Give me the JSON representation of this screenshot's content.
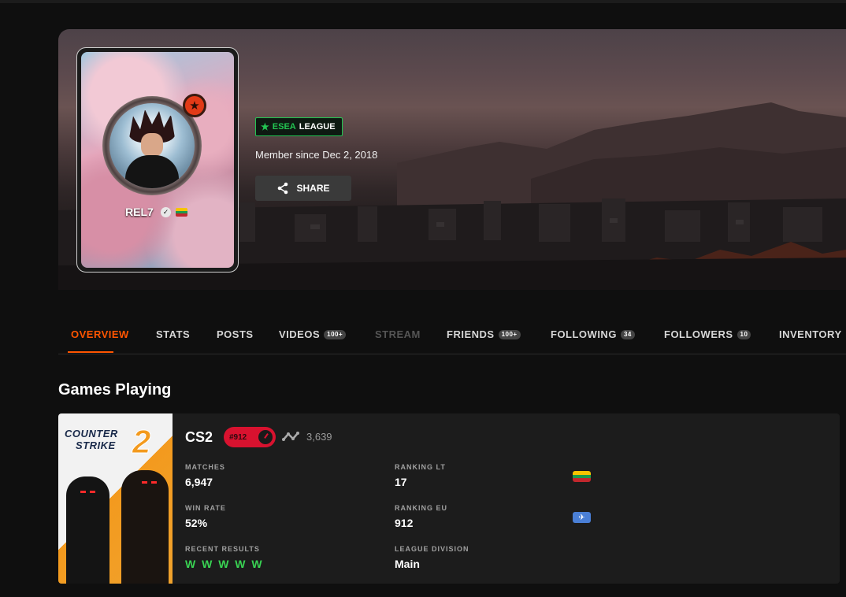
{
  "profile": {
    "nickname": "REL7",
    "esea_label_esea": "ESEA",
    "esea_label_league": "LEAGUE",
    "member_since": "Member since Dec 2, 2018",
    "share_label": "SHARE"
  },
  "tabs": [
    {
      "label": "OVERVIEW",
      "count": null,
      "active": true
    },
    {
      "label": "STATS",
      "count": null
    },
    {
      "label": "POSTS",
      "count": null
    },
    {
      "label": "VIDEOS",
      "count": "100+"
    },
    {
      "label": "STREAM",
      "count": null,
      "disabled": true
    },
    {
      "label": "FRIENDS",
      "count": "100+"
    },
    {
      "label": "FOLLOWING",
      "count": "34"
    },
    {
      "label": "FOLLOWERS",
      "count": "10"
    },
    {
      "label": "INVENTORY",
      "count": null
    }
  ],
  "games_section": {
    "title": "Games Playing",
    "game": {
      "cover_line1": "COUNTER",
      "cover_line2": "STRIKE",
      "cover_number": "2",
      "name": "CS2",
      "elo_rank": "#912",
      "elo": "3,639",
      "stats": {
        "matches_label": "MATCHES",
        "matches": "6,947",
        "win_rate_label": "WIN RATE",
        "win_rate": "52%",
        "recent_label": "RECENT RESULTS",
        "recent": "W W W W W",
        "ranking_lt_label": "RANKING LT",
        "ranking_lt": "17",
        "ranking_eu_label": "RANKING EU",
        "ranking_eu": "912",
        "division_label": "LEAGUE DIVISION",
        "division": "Main"
      }
    }
  },
  "colors": {
    "accent": "#ff5500",
    "esea": "#23c552",
    "win": "#39d353",
    "elo_badge": "#d8122f"
  }
}
